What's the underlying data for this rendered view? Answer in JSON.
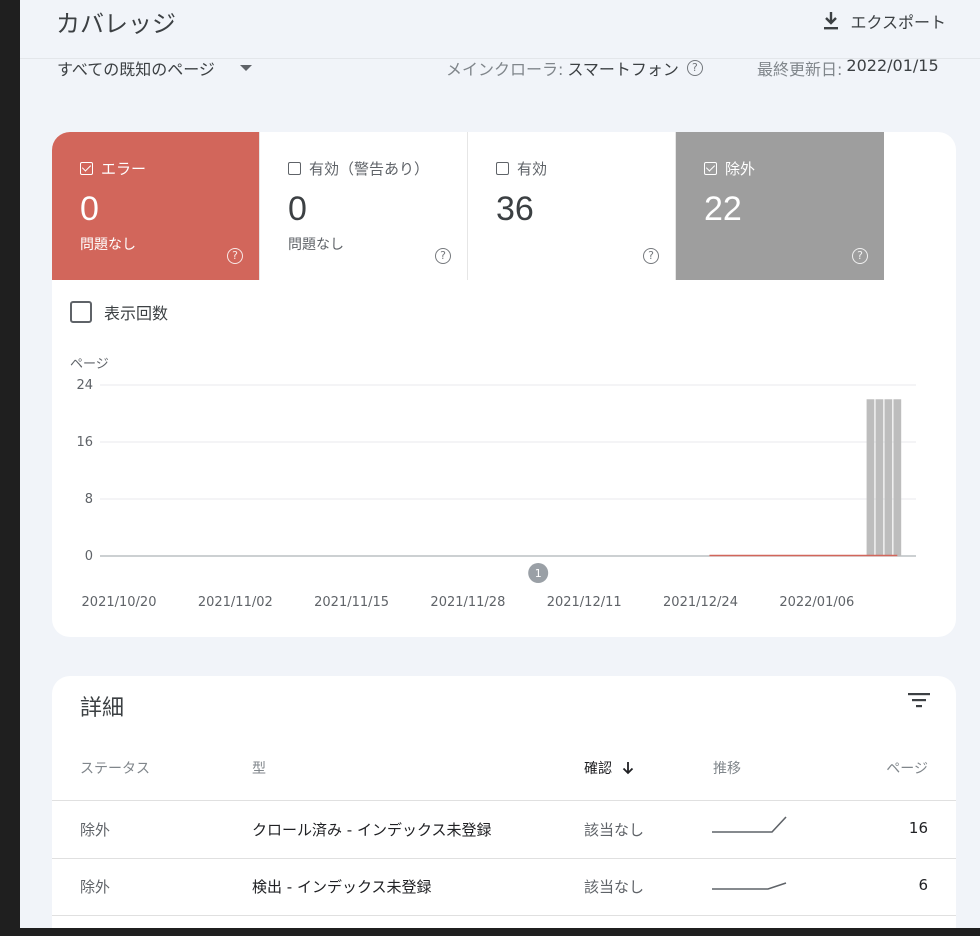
{
  "header": {
    "title": "カバレッジ",
    "export_label": "エクスポート"
  },
  "subbar": {
    "page_filter": "すべての既知のページ",
    "crawler_label": "メインクローラ:",
    "crawler_value": "スマートフォン",
    "updated_label": "最終更新日:",
    "updated_value": "2022/01/15"
  },
  "tiles": [
    {
      "label": "エラー",
      "count": "0",
      "sub": "問題なし",
      "checked": true,
      "color": "#d2665b"
    },
    {
      "label": "有効（警告あり）",
      "count": "0",
      "sub": "問題なし",
      "checked": false
    },
    {
      "label": "有効",
      "count": "36",
      "sub": "",
      "checked": false
    },
    {
      "label": "除外",
      "count": "22",
      "sub": "",
      "checked": true,
      "color": "#9e9e9e"
    }
  ],
  "impressions_label": "表示回数",
  "chart_data": {
    "type": "bar",
    "ylabel": "ページ",
    "yticks": [
      0,
      8,
      16,
      24
    ],
    "ylim": [
      0,
      24
    ],
    "xtick_labels": [
      "2021/10/20",
      "2021/11/02",
      "2021/11/15",
      "2021/11/28",
      "2021/12/11",
      "2021/12/24",
      "2022/01/06"
    ],
    "annotation": {
      "label": "1",
      "date": "2021/12/11"
    },
    "series": [
      {
        "name": "除外",
        "color": "#bdbdbd",
        "points": [
          [
            "2022/01/12",
            22
          ],
          [
            "2022/01/13",
            22
          ],
          [
            "2022/01/14",
            22
          ],
          [
            "2022/01/15",
            22
          ]
        ]
      },
      {
        "name": "エラー",
        "color": "#d2665b",
        "points": [
          [
            "2021/12/25",
            0
          ],
          [
            "2022/01/15",
            0
          ]
        ]
      }
    ],
    "grid": true
  },
  "details": {
    "title": "詳細",
    "columns": {
      "status": "ステータス",
      "type": "型",
      "verify": "確認",
      "trend": "推移",
      "pages": "ページ"
    },
    "rows": [
      {
        "status": "除外",
        "type": "クロール済み - インデックス未登録",
        "verify": "該当なし",
        "pages": "16"
      },
      {
        "status": "除外",
        "type": "検出 - インデックス未登録",
        "verify": "該当なし",
        "pages": "6"
      }
    ]
  }
}
